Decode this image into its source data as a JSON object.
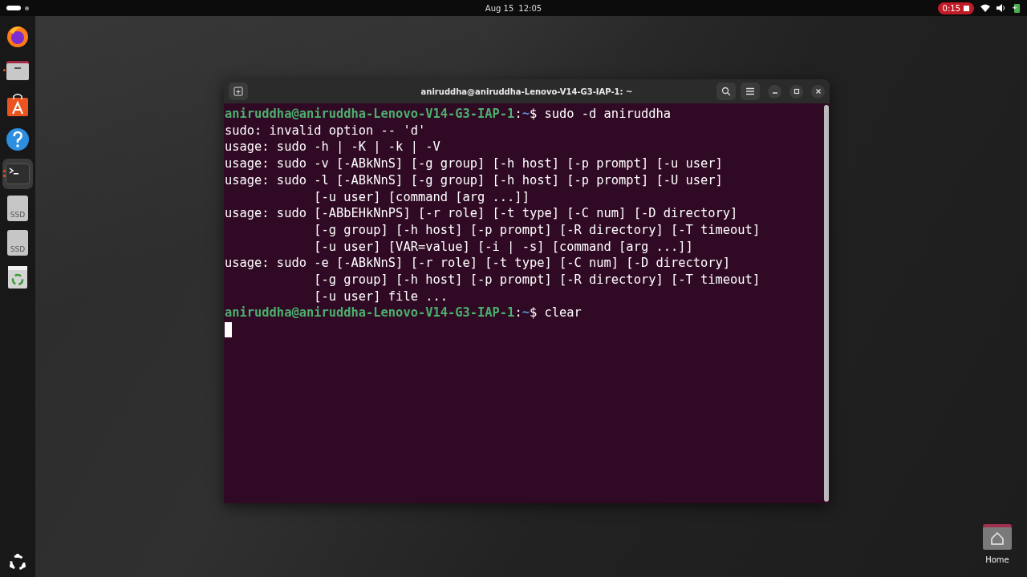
{
  "top_bar": {
    "date": "Aug 15",
    "time": "12:05",
    "recording": "0:15"
  },
  "dock": {
    "items": [
      {
        "kind": "firefox",
        "running": false,
        "focused": false
      },
      {
        "kind": "files",
        "running": true,
        "focused": false
      },
      {
        "kind": "software",
        "running": false,
        "focused": false
      },
      {
        "kind": "help",
        "running": false,
        "focused": false
      },
      {
        "kind": "terminal",
        "running": true,
        "focused": true
      },
      {
        "kind": "drive",
        "label": "SSD",
        "running": false,
        "focused": false
      },
      {
        "kind": "drive",
        "label": "SSD",
        "running": false,
        "focused": false
      },
      {
        "kind": "trash",
        "running": false,
        "focused": false
      }
    ]
  },
  "window": {
    "title": "aniruddha@aniruddha-Lenovo-V14-G3-IAP-1: ~"
  },
  "terminal": {
    "cursor": true,
    "lines": [
      {
        "kind": "prompt",
        "user": "aniruddha@aniruddha-Lenovo-V14-G3-IAP-1",
        "separator": ":",
        "path": "~",
        "command": "$ sudo -d aniruddha"
      },
      {
        "kind": "output",
        "text": "sudo: invalid option -- 'd'"
      },
      {
        "kind": "output",
        "text": "usage: sudo -h | -K | -k | -V"
      },
      {
        "kind": "output",
        "text": "usage: sudo -v [-ABkNnS] [-g group] [-h host] [-p prompt] [-u user]"
      },
      {
        "kind": "output",
        "text": "usage: sudo -l [-ABkNnS] [-g group] [-h host] [-p prompt] [-U user]"
      },
      {
        "kind": "output",
        "text": "            [-u user] [command [arg ...]]"
      },
      {
        "kind": "output",
        "text": "usage: sudo [-ABbEHkNnPS] [-r role] [-t type] [-C num] [-D directory]"
      },
      {
        "kind": "output",
        "text": "            [-g group] [-h host] [-p prompt] [-R directory] [-T timeout]"
      },
      {
        "kind": "output",
        "text": "            [-u user] [VAR=value] [-i | -s] [command [arg ...]]"
      },
      {
        "kind": "output",
        "text": "usage: sudo -e [-ABkNnS] [-r role] [-t type] [-C num] [-D directory]"
      },
      {
        "kind": "output",
        "text": "            [-g group] [-h host] [-p prompt] [-R directory] [-T timeout]"
      },
      {
        "kind": "output",
        "text": "            [-u user] file ..."
      },
      {
        "kind": "prompt",
        "user": "aniruddha@aniruddha-Lenovo-V14-G3-IAP-1",
        "separator": ":",
        "path": "~",
        "command": "$ clear"
      }
    ]
  },
  "desktop_icons": [
    {
      "label": "Home"
    }
  ]
}
